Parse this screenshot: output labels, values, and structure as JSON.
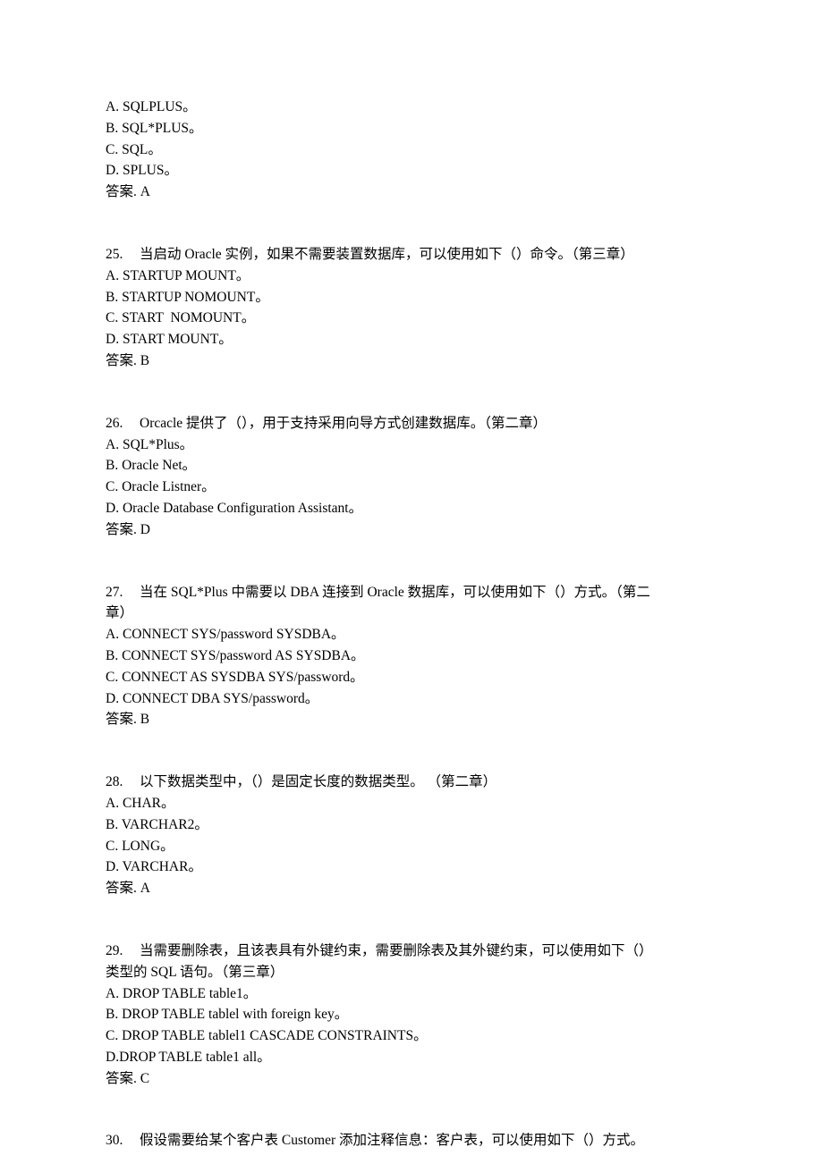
{
  "document": {
    "page_background": "#ffffff",
    "text_color": "#000000",
    "blocks": [
      {
        "type": "options_tail",
        "number": "",
        "stem_lines": [],
        "options": [
          "A. SQLPLUS。",
          "B. SQL*PLUS。",
          "C. SQL。",
          "D. SPLUS。"
        ],
        "answer": "答案. A"
      },
      {
        "type": "question",
        "number": "25.",
        "stem_lines": [
          "当启动 Oracle 实例，如果不需要装置数据库，可以使用如下（）命令。（第三章）"
        ],
        "options": [
          "A. STARTUP MOUNT。",
          "B. STARTUP NOMOUNT。",
          "C. START  NOMOUNT。",
          "D. START MOUNT。"
        ],
        "answer": "答案. B"
      },
      {
        "type": "question",
        "number": "26.",
        "stem_lines": [
          "Orcacle 提供了（），用于支持采用向导方式创建数据库。（第二章）"
        ],
        "options": [
          "A. SQL*Plus。",
          "B. Oracle Net。",
          "C. Oracle Listner。",
          "D. Oracle Database Configuration Assistant。"
        ],
        "answer": "答案. D"
      },
      {
        "type": "question",
        "number": "27.",
        "stem_lines": [
          "当在 SQL*Plus 中需要以 DBA 连接到 Oracle 数据库，可以使用如下（）方式。（第二",
          "章）"
        ],
        "options": [
          "A. CONNECT SYS/password SYSDBA。",
          "B. CONNECT SYS/password AS SYSDBA。",
          "C. CONNECT AS SYSDBA SYS/password。",
          "D. CONNECT DBA SYS/password。"
        ],
        "answer": "答案. B"
      },
      {
        "type": "question",
        "number": "28.",
        "stem_lines": [
          "以下数据类型中，（）是固定长度的数据类型。 （第二章）"
        ],
        "options": [
          "A. CHAR。",
          "B. VARCHAR2。",
          "C. LONG。",
          "D. VARCHAR。"
        ],
        "answer": "答案. A"
      },
      {
        "type": "question",
        "number": "29.",
        "stem_lines": [
          "当需要删除表，且该表具有外键约束，需要删除表及其外键约束，可以使用如下（）",
          "类型的 SQL 语句。（第三章）"
        ],
        "options": [
          "A. DROP TABLE table1。",
          "B. DROP TABLE tablel with foreign key。",
          "C. DROP TABLE tablel1 CASCADE CONSTRAINTS。",
          "D.DROP TABLE table1 all。"
        ],
        "answer": "答案. C"
      },
      {
        "type": "question",
        "number": "30.",
        "stem_lines": [
          "假设需要给某个客户表 Customer 添加注释信息：客户表，可以使用如下（）方式。"
        ],
        "options": [],
        "answer": ""
      }
    ]
  }
}
